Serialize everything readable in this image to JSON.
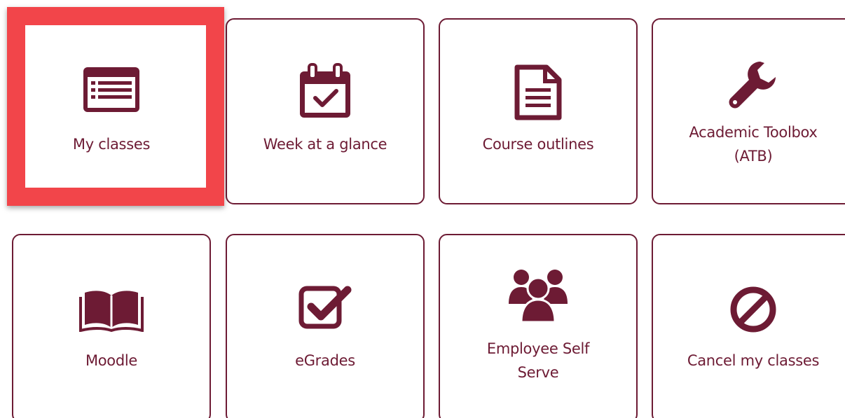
{
  "colors": {
    "accent": "#6d1b34",
    "highlight": "#f2454a",
    "background": "#ffffff"
  },
  "tiles": [
    {
      "label": "My classes",
      "icon": "class-list-icon",
      "highlighted": true
    },
    {
      "label": "Week at a glance",
      "icon": "calendar-check-icon"
    },
    {
      "label": "Course outlines",
      "icon": "document-icon"
    },
    {
      "label_line1": "Academic Toolbox",
      "label_line2": "(ATB)",
      "icon": "wrench-icon"
    },
    {
      "label": "Moodle",
      "icon": "open-book-icon"
    },
    {
      "label": "eGrades",
      "icon": "checkbox-icon"
    },
    {
      "label_line1": "Employee Self",
      "label_line2": "Serve",
      "icon": "users-group-icon"
    },
    {
      "label": "Cancel my classes",
      "icon": "cancel-icon"
    }
  ]
}
